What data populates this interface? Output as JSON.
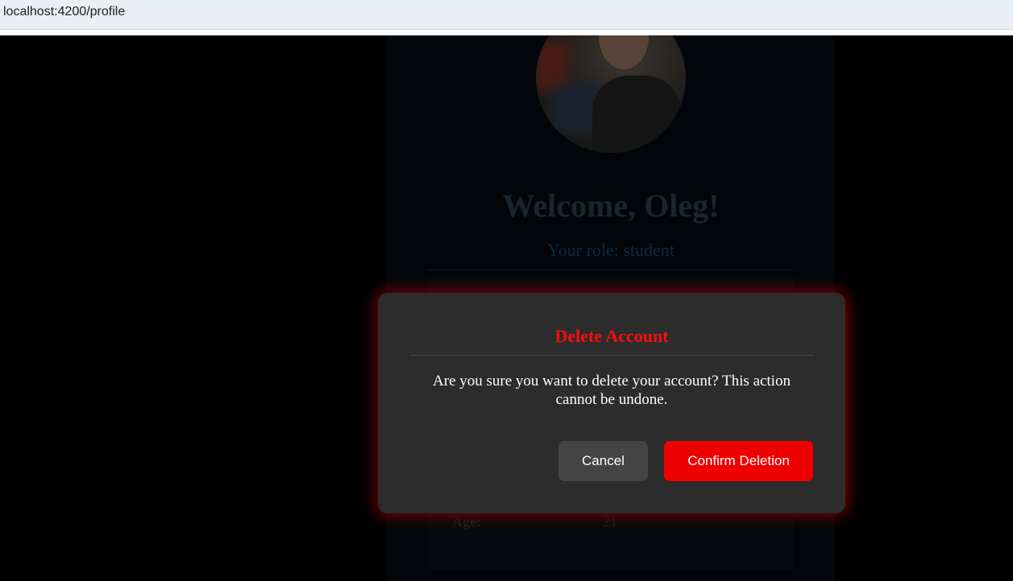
{
  "browser": {
    "url": "localhost:4200/profile"
  },
  "profile": {
    "welcome": "Welcome, Oleg!",
    "role": "Your role: student",
    "age_label": "Age:",
    "age_value": "21"
  },
  "dialog": {
    "title": "Delete Account",
    "message": "Are you sure you want to delete your account? This action cannot be undone.",
    "cancel_label": "Cancel",
    "confirm_label": "Confirm Deletion"
  },
  "colors": {
    "danger": "#ee0000",
    "dialog_bg": "#2c2c2c",
    "cancel_bg": "#444444",
    "overlay": "#000000"
  }
}
